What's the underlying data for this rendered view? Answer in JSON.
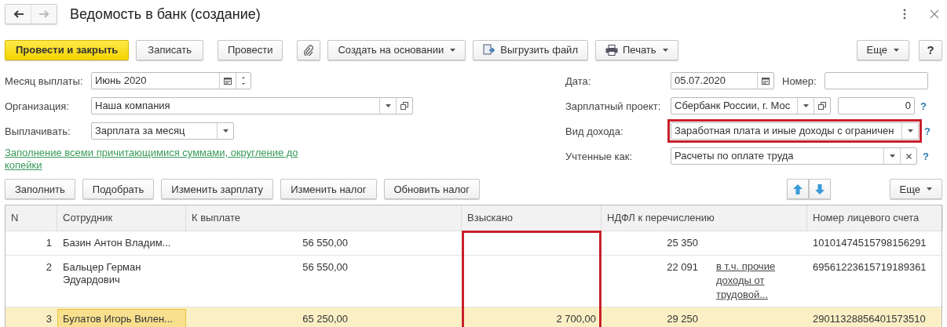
{
  "window": {
    "title": "Ведомость в банк (создание)"
  },
  "toolbar": [
    {
      "kind": "primary",
      "label": "Провести и закрыть"
    },
    {
      "kind": "plain",
      "label": "Записать"
    },
    {
      "kind": "plain",
      "label": "Провести"
    },
    {
      "kind": "clip"
    },
    {
      "kind": "menu",
      "label": "Создать на основании"
    },
    {
      "kind": "upload",
      "label": "Выгрузить файл"
    },
    {
      "kind": "print",
      "label": "Печать"
    }
  ],
  "more_button": "Еще",
  "help_button": "?",
  "left_fields": [
    {
      "label": "Месяц выплаты:",
      "value": "Июнь 2020",
      "buttons": [
        {
          "kind": "calendar"
        },
        {
          "kind": "spin"
        }
      ]
    },
    {
      "label": "Организация:",
      "value": "Наша компания",
      "buttons": [
        {
          "kind": "dropdown"
        },
        {
          "kind": "open"
        }
      ]
    },
    {
      "label": "Выплачивать:",
      "value": "Зарплата за месяц",
      "buttons": [
        {
          "kind": "dropdown"
        }
      ]
    }
  ],
  "fill_link": "Заполнение всеми причитающимися суммами, округление до копейки",
  "date_field": {
    "label": "Дата:",
    "value": "05.07.2020",
    "buttons": [
      {
        "kind": "calendar"
      }
    ]
  },
  "number_field": {
    "label": "Номер:"
  },
  "right_fields": [
    {
      "label": "Зарплатный проект:",
      "value": "Сбербанк России, г. Мос",
      "buttons": [
        {
          "kind": "dropdown"
        },
        {
          "kind": "open"
        }
      ],
      "extra": "0",
      "help": "?",
      "highlighted": false
    },
    {
      "label": "Вид дохода:",
      "value": "Заработная плата и иные доходы с ограничен",
      "buttons": [
        {
          "kind": "dropdown"
        }
      ],
      "help": "?",
      "highlighted": true
    },
    {
      "label": "Учтенные как:",
      "value": "Расчеты по оплате труда",
      "buttons": [
        {
          "kind": "dropdown"
        },
        {
          "kind": "clear"
        }
      ],
      "help": "?",
      "highlighted": false
    }
  ],
  "table_toolbar": [
    "Заполнить",
    "Подобрать",
    "Изменить зарплату",
    "Изменить налог",
    "Обновить налог"
  ],
  "table_more": "Еще",
  "table": {
    "columns": [
      {
        "label": "N",
        "highlighted": false
      },
      {
        "label": "Сотрудник",
        "highlighted": false
      },
      {
        "label": "К выплате",
        "highlighted": false
      },
      {
        "label": "Взыскано",
        "highlighted": true
      },
      {
        "label": "НДФЛ к перечислению",
        "highlighted": false
      },
      {
        "label": "Номер лицевого счета",
        "highlighted": false
      }
    ],
    "rows": [
      {
        "n": "1",
        "employee": "Базин Антон Владим...",
        "payout": "56 550,00",
        "withheld": "",
        "tax": "25 350",
        "tax_note": "",
        "account": "10101474515798156291",
        "selected": false
      },
      {
        "n": "2",
        "employee": "Бальцер Герман Эдуардович",
        "payout": "56 550,00",
        "withheld": "",
        "tax": "22 091",
        "tax_note": "в т.ч. прочие доходы от трудовой...",
        "account": "69561223615719189361",
        "selected": false
      },
      {
        "n": "3",
        "employee": "Булатов Игорь Вилен...",
        "payout": "65 250,00",
        "withheld": "2 700,00",
        "tax": "29 250",
        "tax_note": "",
        "account": "29011328856401573510",
        "selected": true
      }
    ]
  }
}
